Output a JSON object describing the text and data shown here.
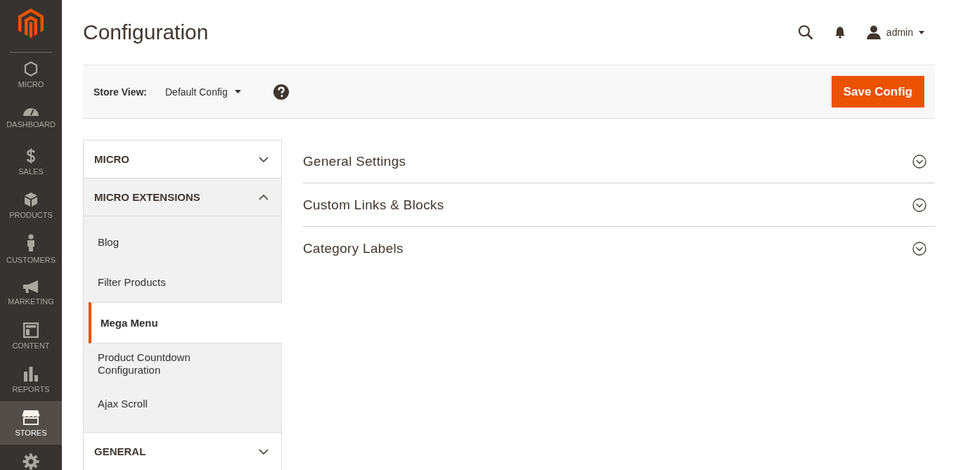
{
  "nav": [
    {
      "label": "MICRO",
      "selected": false
    },
    {
      "label": "DASHBOARD",
      "selected": false
    },
    {
      "label": "SALES",
      "selected": false
    },
    {
      "label": "PRODUCTS",
      "selected": false
    },
    {
      "label": "CUSTOMERS",
      "selected": false
    },
    {
      "label": "MARKETING",
      "selected": false
    },
    {
      "label": "CONTENT",
      "selected": false
    },
    {
      "label": "REPORTS",
      "selected": false
    },
    {
      "label": "STORES",
      "selected": true
    }
  ],
  "page_title": "Configuration",
  "user": {
    "name": "admin"
  },
  "store_view": {
    "label": "Store View:",
    "value": "Default Config"
  },
  "save_button": "Save Config",
  "groups": [
    {
      "title": "MICRO",
      "expanded": false
    },
    {
      "title": "MICRO EXTENSIONS",
      "expanded": true,
      "children": [
        {
          "label": "Blog",
          "selected": false
        },
        {
          "label": "Filter Products",
          "selected": false
        },
        {
          "label": "Mega Menu",
          "selected": true
        },
        {
          "label": "Product Countdown Configuration",
          "selected": false
        },
        {
          "label": "Ajax Scroll",
          "selected": false
        }
      ]
    },
    {
      "title": "GENERAL",
      "expanded": false
    }
  ],
  "sections": [
    {
      "title": "General Settings",
      "expanded": false
    },
    {
      "title": "Custom Links & Blocks",
      "expanded": false
    },
    {
      "title": "Category Labels",
      "expanded": false
    }
  ]
}
